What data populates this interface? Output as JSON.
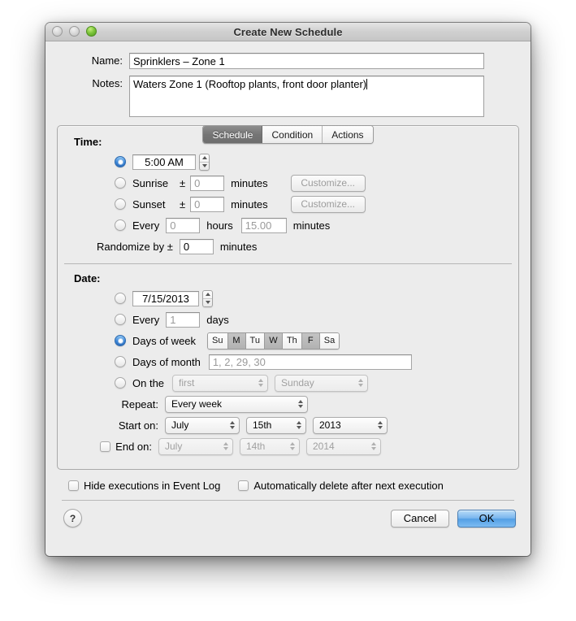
{
  "window": {
    "title": "Create New Schedule",
    "lights": [
      "close",
      "minimize",
      "zoom"
    ]
  },
  "fields": {
    "name_label": "Name:",
    "name_value": "Sprinklers – Zone 1",
    "notes_label": "Notes:",
    "notes_value": "Waters Zone 1 (Rooftop plants, front door planter)"
  },
  "tabs": [
    {
      "label": "Schedule",
      "selected": true
    },
    {
      "label": "Condition",
      "selected": false
    },
    {
      "label": "Actions",
      "selected": false
    }
  ],
  "time": {
    "section_label": "Time:",
    "clock_value": "5:00 AM",
    "sunrise_label": "Sunrise",
    "sunrise_pm": "±",
    "sunrise_offset": "0",
    "sunrise_unit": "minutes",
    "sunrise_customize": "Customize...",
    "sunset_label": "Sunset",
    "sunset_pm": "±",
    "sunset_offset": "0",
    "sunset_unit": "minutes",
    "sunset_customize": "Customize...",
    "every_label": "Every",
    "every_hours": "0",
    "hours_unit": "hours",
    "every_minutes": "15.00",
    "minutes_unit": "minutes",
    "randomize_label": "Randomize by ±",
    "randomize_value": "0",
    "randomize_unit": "minutes"
  },
  "date": {
    "section_label": "Date:",
    "specific_date": "7/15/2013",
    "every_label": "Every",
    "every_days": "1",
    "days_unit": "days",
    "days_of_week_label": "Days of week",
    "weekdays": [
      {
        "label": "Su",
        "selected": false
      },
      {
        "label": "M",
        "selected": true
      },
      {
        "label": "Tu",
        "selected": false
      },
      {
        "label": "W",
        "selected": true
      },
      {
        "label": "Th",
        "selected": false
      },
      {
        "label": "F",
        "selected": true
      },
      {
        "label": "Sa",
        "selected": false
      }
    ],
    "days_of_month_label": "Days of month",
    "days_of_month_value": "1, 2, 29, 30",
    "on_the_label": "On the",
    "on_the_ordinal": "first",
    "on_the_weekday": "Sunday",
    "repeat_label": "Repeat:",
    "repeat_value": "Every week",
    "start_on_label": "Start on:",
    "start_month": "July",
    "start_day": "15th",
    "start_year": "2013",
    "end_on_label": "End on:",
    "end_month": "July",
    "end_day": "14th",
    "end_year": "2014"
  },
  "options": {
    "hide_executions": "Hide executions in Event Log",
    "auto_delete": "Automatically delete after next execution"
  },
  "buttons": {
    "help": "?",
    "cancel": "Cancel",
    "ok": "OK"
  },
  "colors": {
    "accent_blue": "#3d87d8",
    "default_button": "#79b6ee",
    "window_bg": "#ececec",
    "selected_tab": "#757575"
  }
}
